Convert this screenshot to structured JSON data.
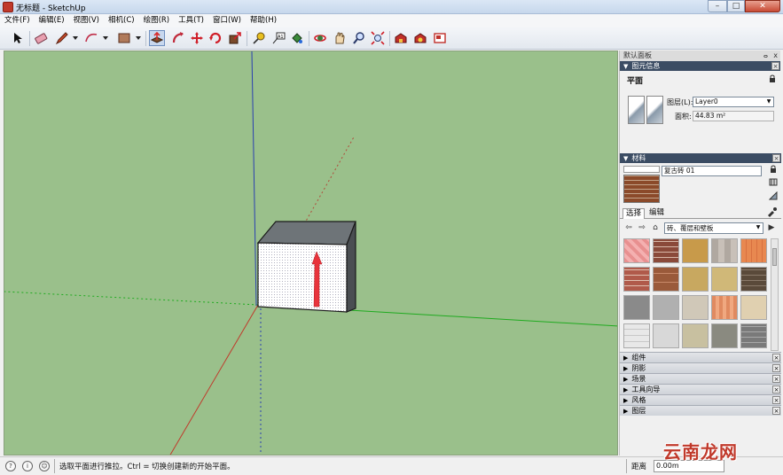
{
  "window": {
    "title": "无标题 - SketchUp",
    "minimize": "–",
    "maximize": "□",
    "close": "✕"
  },
  "menu": [
    {
      "label": "文件(F)"
    },
    {
      "label": "编辑(E)"
    },
    {
      "label": "视图(V)"
    },
    {
      "label": "相机(C)"
    },
    {
      "label": "绘图(R)"
    },
    {
      "label": "工具(T)"
    },
    {
      "label": "窗口(W)"
    },
    {
      "label": "帮助(H)"
    }
  ],
  "toolbar": {
    "icons": [
      "select-icon",
      "eraser-icon",
      "pencil-icon",
      "arc-icon",
      "rectangle-icon",
      "push-pull-icon",
      "follow-me-icon",
      "move-icon",
      "rotate-icon",
      "scale-icon",
      "tape-measure-icon",
      "text-icon",
      "paint-bucket-icon",
      "orbit-icon",
      "pan-icon",
      "zoom-icon",
      "zoom-extents-icon",
      "warehouse-icon",
      "extension-warehouse-icon",
      "send-to-layout-icon"
    ],
    "active": "push-pull-icon"
  },
  "colors": {
    "viewport_bg": "#9ac08b",
    "red_axis": "#c0392b",
    "green_axis": "#1faa1f",
    "blue_axis": "#2a3fb0",
    "tray_header": "#3b4c63",
    "push_arrow": "#e8343c"
  },
  "panel": {
    "header": "默认面板",
    "pin": "ⴰ",
    "close": "x",
    "entity_info": {
      "title": "图元信息",
      "entity_type": "平面",
      "layer_label": "图层(L):",
      "layer_value": "Layer0",
      "area_label": "面积:",
      "area_value": "44.83 m²"
    },
    "materials": {
      "title": "材料",
      "material_name": "复古砖 01",
      "tab_select": "选择",
      "tab_edit": "编辑",
      "library": "砖、覆层和壁板"
    },
    "collapsed_trays": [
      {
        "label": "组件"
      },
      {
        "label": "阴影"
      },
      {
        "label": "场景"
      },
      {
        "label": "工具向导"
      },
      {
        "label": "风格"
      },
      {
        "label": "图层"
      }
    ]
  },
  "status": {
    "hint": "选取平面进行推拉。Ctrl = 切换创建新的开始平面。",
    "measure_label": "距离",
    "measure_value": "0.00m"
  },
  "watermark": "云南龙网"
}
